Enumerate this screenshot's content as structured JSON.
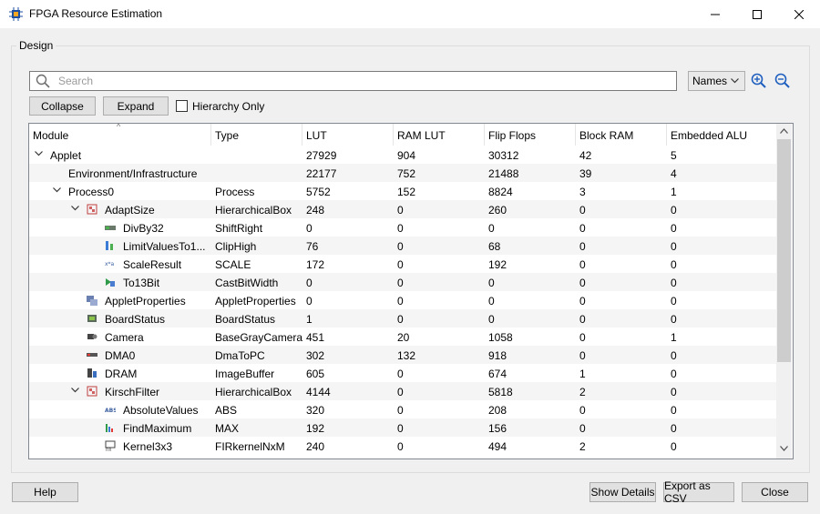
{
  "window": {
    "title": "FPGA Resource Estimation"
  },
  "group_label": "Design",
  "search": {
    "placeholder": "Search"
  },
  "view_mode": "Names",
  "toolbar": {
    "collapse": "Collapse",
    "expand": "Expand",
    "hierarchy_only": "Hierarchy Only"
  },
  "columns": [
    "Module",
    "Type",
    "LUT",
    "RAM LUT",
    "Flip Flops",
    "Block RAM",
    "Embedded ALU"
  ],
  "rows": [
    {
      "level": 0,
      "expander": "down",
      "icon": "none",
      "module": "Applet",
      "type": "",
      "lut": "27929",
      "ramlut": "904",
      "ff": "30312",
      "bram": "42",
      "alu": "5"
    },
    {
      "level": 1,
      "expander": "none",
      "icon": "none",
      "module": "Environment/Infrastructure",
      "type": "",
      "lut": "22177",
      "ramlut": "752",
      "ff": "21488",
      "bram": "39",
      "alu": "4"
    },
    {
      "level": 1,
      "expander": "down",
      "icon": "none",
      "module": "Process0",
      "type": "Process",
      "lut": "5752",
      "ramlut": "152",
      "ff": "8824",
      "bram": "3",
      "alu": "1"
    },
    {
      "level": 2,
      "expander": "down",
      "icon": "hierarchy-box-icon",
      "module": "AdaptSize",
      "type": "HierarchicalBox",
      "lut": "248",
      "ramlut": "0",
      "ff": "260",
      "bram": "0",
      "alu": "0"
    },
    {
      "level": 3,
      "expander": "none",
      "icon": "shift-right-icon",
      "module": "DivBy32",
      "type": "ShiftRight",
      "lut": "0",
      "ramlut": "0",
      "ff": "0",
      "bram": "0",
      "alu": "0"
    },
    {
      "level": 3,
      "expander": "none",
      "icon": "clip-high-icon",
      "module": "LimitValuesTo1...",
      "type": "ClipHigh",
      "lut": "76",
      "ramlut": "0",
      "ff": "68",
      "bram": "0",
      "alu": "0"
    },
    {
      "level": 3,
      "expander": "none",
      "icon": "scale-icon",
      "module": "ScaleResult",
      "type": "SCALE",
      "lut": "172",
      "ramlut": "0",
      "ff": "192",
      "bram": "0",
      "alu": "0"
    },
    {
      "level": 3,
      "expander": "none",
      "icon": "cast-bitwidth-icon",
      "module": "To13Bit",
      "type": "CastBitWidth",
      "lut": "0",
      "ramlut": "0",
      "ff": "0",
      "bram": "0",
      "alu": "0"
    },
    {
      "level": 2,
      "expander": "none",
      "icon": "applet-properties-icon",
      "module": "AppletProperties",
      "type": "AppletProperties",
      "lut": "0",
      "ramlut": "0",
      "ff": "0",
      "bram": "0",
      "alu": "0"
    },
    {
      "level": 2,
      "expander": "none",
      "icon": "board-status-icon",
      "module": "BoardStatus",
      "type": "BoardStatus",
      "lut": "1",
      "ramlut": "0",
      "ff": "0",
      "bram": "0",
      "alu": "0"
    },
    {
      "level": 2,
      "expander": "none",
      "icon": "camera-icon",
      "module": "Camera",
      "type": "BaseGrayCamera",
      "lut": "451",
      "ramlut": "20",
      "ff": "1058",
      "bram": "0",
      "alu": "1"
    },
    {
      "level": 2,
      "expander": "none",
      "icon": "dma-icon",
      "module": "DMA0",
      "type": "DmaToPC",
      "lut": "302",
      "ramlut": "132",
      "ff": "918",
      "bram": "0",
      "alu": "0"
    },
    {
      "level": 2,
      "expander": "none",
      "icon": "dram-icon",
      "module": "DRAM",
      "type": "ImageBuffer",
      "lut": "605",
      "ramlut": "0",
      "ff": "674",
      "bram": "1",
      "alu": "0"
    },
    {
      "level": 2,
      "expander": "down",
      "icon": "hierarchy-box-icon",
      "module": "KirschFilter",
      "type": "HierarchicalBox",
      "lut": "4144",
      "ramlut": "0",
      "ff": "5818",
      "bram": "2",
      "alu": "0"
    },
    {
      "level": 3,
      "expander": "none",
      "icon": "abs-icon",
      "module": "AbsoluteValues",
      "type": "ABS",
      "lut": "320",
      "ramlut": "0",
      "ff": "208",
      "bram": "0",
      "alu": "0"
    },
    {
      "level": 3,
      "expander": "none",
      "icon": "max-icon",
      "module": "FindMaximum",
      "type": "MAX",
      "lut": "192",
      "ramlut": "0",
      "ff": "156",
      "bram": "0",
      "alu": "0"
    },
    {
      "level": 3,
      "expander": "none",
      "icon": "fir-kernel-icon",
      "module": "Kernel3x3",
      "type": "FIRkernelNxM",
      "lut": "240",
      "ramlut": "0",
      "ff": "494",
      "bram": "2",
      "alu": "0"
    }
  ],
  "footer": {
    "help": "Help",
    "show_details": "Show Details",
    "export_csv": "Export as CSV",
    "close": "Close"
  }
}
